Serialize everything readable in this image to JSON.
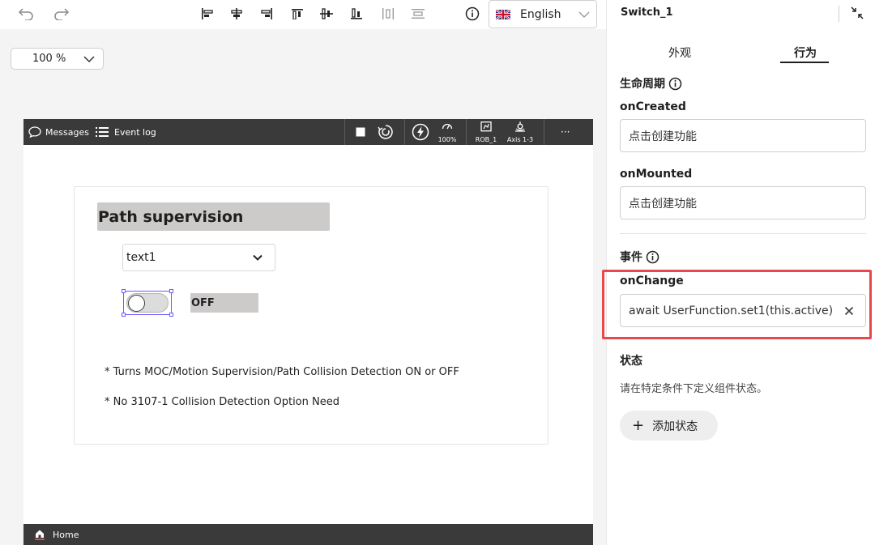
{
  "toolbar": {
    "undo": "undo",
    "redo": "redo",
    "language": "English",
    "zoom": "100 %"
  },
  "device": {
    "messages": "Messages",
    "event_log": "Event log",
    "speed": "100%",
    "robot": "ROB_1",
    "axis": "Axis 1-3",
    "more": "···",
    "home": "Home"
  },
  "card": {
    "title": "Path supervision",
    "dropdown_value": "text1",
    "switch_label": "OFF",
    "note1": "* Turns MOC/Motion Supervision/Path Collision Detection ON or OFF",
    "note2": "* No 3107-1 Collision Detection Option Need"
  },
  "panel": {
    "title": "Switch_1",
    "tabs": [
      "外观",
      "行为"
    ],
    "active_tab": "行为",
    "lifecycle": {
      "heading": "生命周期",
      "on_created_label": "onCreated",
      "on_created_value": "点击创建功能",
      "on_mounted_label": "onMounted",
      "on_mounted_value": "点击创建功能"
    },
    "events": {
      "heading": "事件",
      "on_change_label": "onChange",
      "on_change_value": "await UserFunction.set1(this.active)"
    },
    "state": {
      "heading": "状态",
      "description": "请在特定条件下定义组件状态。",
      "add_button": "添加状态"
    }
  },
  "colors": {
    "highlight": "#e8474c",
    "selection": "#6b5cff",
    "device_bar": "#3a3a3a"
  }
}
